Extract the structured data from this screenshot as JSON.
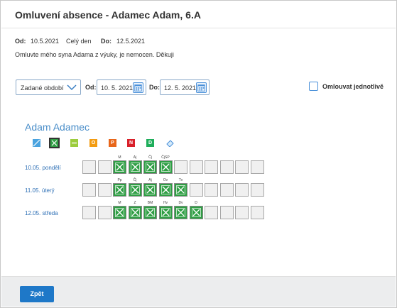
{
  "dialog": {
    "title": "Omluvení absence - Adamec Adam, 6.A",
    "from_label": "Od:",
    "from_value": "10.5.2021",
    "full_day": "Celý den",
    "to_label": "Do:",
    "to_value": "12.5.2021",
    "message": "Omluvte mého  syna Adama z výuky, je nemocen. Děkuji"
  },
  "filter": {
    "period_select": "Zadané období",
    "od_label": "Od:",
    "od_value": "10. 5. 2021",
    "do_label": "Do:",
    "do_value": "12. 5. 2021",
    "individual_label": "Omlouvat jednotlivě",
    "individual_checked": false
  },
  "student": {
    "name": "Adam Adamec"
  },
  "tools": [
    {
      "name": "clear-tool",
      "glyph": "",
      "color": "#4aa3df"
    },
    {
      "name": "excused-tool",
      "glyph": "✕",
      "color": "#2f9e44",
      "selected": true
    },
    {
      "name": "minus-tool",
      "glyph": "—",
      "color": "#9ccc3d"
    },
    {
      "name": "o-tool",
      "glyph": "O",
      "color": "#f39c12"
    },
    {
      "name": "p-tool",
      "glyph": "P",
      "color": "#e8661a"
    },
    {
      "name": "n-tool",
      "glyph": "N",
      "color": "#d9202a"
    },
    {
      "name": "d-tool",
      "glyph": "D",
      "color": "#1fae5b"
    },
    {
      "name": "eraser-tool",
      "glyph": "",
      "color": "#4aa3df"
    }
  ],
  "days": [
    {
      "label": "10.05. pondělí",
      "lessons": [
        "",
        "",
        "M",
        "Aj",
        "Čj",
        "ČjSP",
        "",
        "",
        "",
        "",
        "",
        ""
      ],
      "excused": [
        false,
        false,
        true,
        true,
        true,
        true,
        false,
        false,
        false,
        false,
        false,
        false
      ]
    },
    {
      "label": "11.05. úterý",
      "lessons": [
        "",
        "",
        "Pp",
        "Čj",
        "Aj",
        "Ov",
        "Tv",
        "",
        "",
        "",
        "",
        ""
      ],
      "excused": [
        false,
        false,
        true,
        true,
        true,
        true,
        true,
        false,
        false,
        false,
        false,
        false
      ]
    },
    {
      "label": "12.05. středa",
      "lessons": [
        "",
        "",
        "M",
        "Z",
        "BM",
        "Hv",
        "Dv",
        "D",
        "",
        "",
        "",
        ""
      ],
      "excused": [
        false,
        false,
        true,
        true,
        true,
        true,
        true,
        true,
        false,
        false,
        false,
        false
      ]
    }
  ],
  "footer": {
    "back_button": "Zpět"
  }
}
